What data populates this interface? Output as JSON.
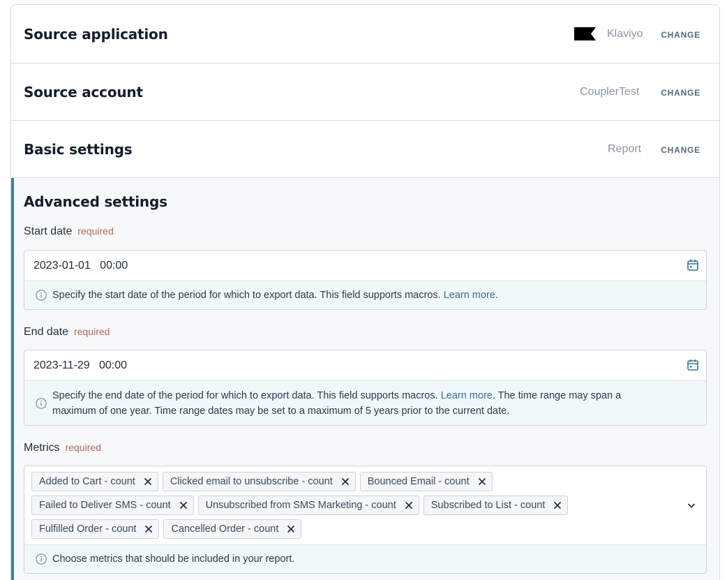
{
  "source_application": {
    "title": "Source application",
    "value": "Klaviyo",
    "change_label": "CHANGE"
  },
  "source_account": {
    "title": "Source account",
    "value": "CouplerTest",
    "change_label": "CHANGE"
  },
  "basic_settings": {
    "title": "Basic settings",
    "value": "Report",
    "change_label": "CHANGE"
  },
  "advanced_settings": {
    "title": "Advanced settings",
    "start_date": {
      "label": "Start date",
      "required": "required",
      "value": "2023-01-01   00:00",
      "hint_text": "Specify the start date of the period for which to export data. This field supports macros. ",
      "hint_link": "Learn more",
      "hint_tail": "."
    },
    "end_date": {
      "label": "End date",
      "required": "required",
      "value": "2023-11-29   00:00",
      "hint_text": "Specify the end date of the period for which to export data. This field supports macros. ",
      "hint_link": "Learn more",
      "hint_tail": ". The time range may span a maximum of one year. Time range dates may be set to a maximum of 5 years prior to the current date."
    },
    "metrics": {
      "label": "Metrics",
      "required": "required",
      "chips": [
        "Added to Cart - count",
        "Clicked email to unsubscribe - count",
        "Bounced Email - count",
        "Failed to Deliver SMS - count",
        "Unsubscribed from SMS Marketing - count",
        "Subscribed to List - count",
        "Fulfilled Order - count",
        "Cancelled Order - count"
      ],
      "hint_text": "Choose metrics that should be included in your report."
    }
  },
  "colors": {
    "accent": "#3d7ea4",
    "required": "#b5665a",
    "link": "#2f6f9b"
  },
  "icons": [
    "klaviyo-logo",
    "calendar-icon",
    "info-icon",
    "close-icon",
    "chevron-down-icon"
  ]
}
